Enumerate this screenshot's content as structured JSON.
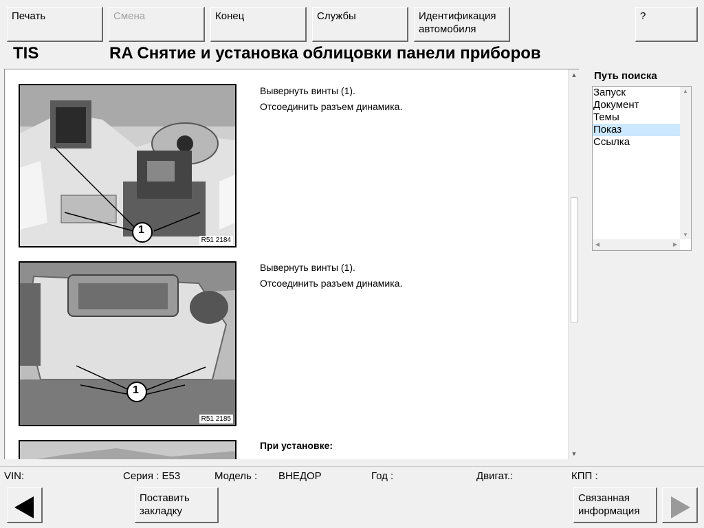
{
  "toolbar": {
    "print": "Печать",
    "change": "Смена",
    "end": "Конец",
    "services": "Службы",
    "vehicle_id": "Идентификация\nавтомобиля",
    "help": "?"
  },
  "header": {
    "app": "TIS",
    "title": "RA  Снятие и установка облицовки панели приборов"
  },
  "content": {
    "steps": [
      {
        "line1": "Вывернуть винты (1).",
        "line2": "Отсоединить разъем динамика.",
        "image_ref": "R51 2184",
        "callout": "1"
      },
      {
        "line1": "Вывернуть винты (1).",
        "line2": "Отсоединить разъем динамика.",
        "image_ref": "R51 2185",
        "callout": "1"
      },
      {
        "heading": "При установке:"
      }
    ]
  },
  "sidebar": {
    "label": "Путь поиска",
    "items": [
      "Запуск",
      "Документ",
      "Темы",
      "Показ",
      "Ссылка"
    ],
    "selected": "Показ"
  },
  "status": {
    "vin_label": "VIN:",
    "series": "Серия : E53",
    "model_label": "Модель :",
    "model_value": "ВНЕДОР",
    "year_label": "Год :",
    "engine_label": "Двигат.:",
    "gearbox_label": "КПП :"
  },
  "bottom": {
    "bookmark": "Поставить\nзакладку",
    "related": "Связанная\nинформация"
  },
  "icons": {
    "back": "arrow-left-icon",
    "forward": "arrow-right-icon"
  }
}
